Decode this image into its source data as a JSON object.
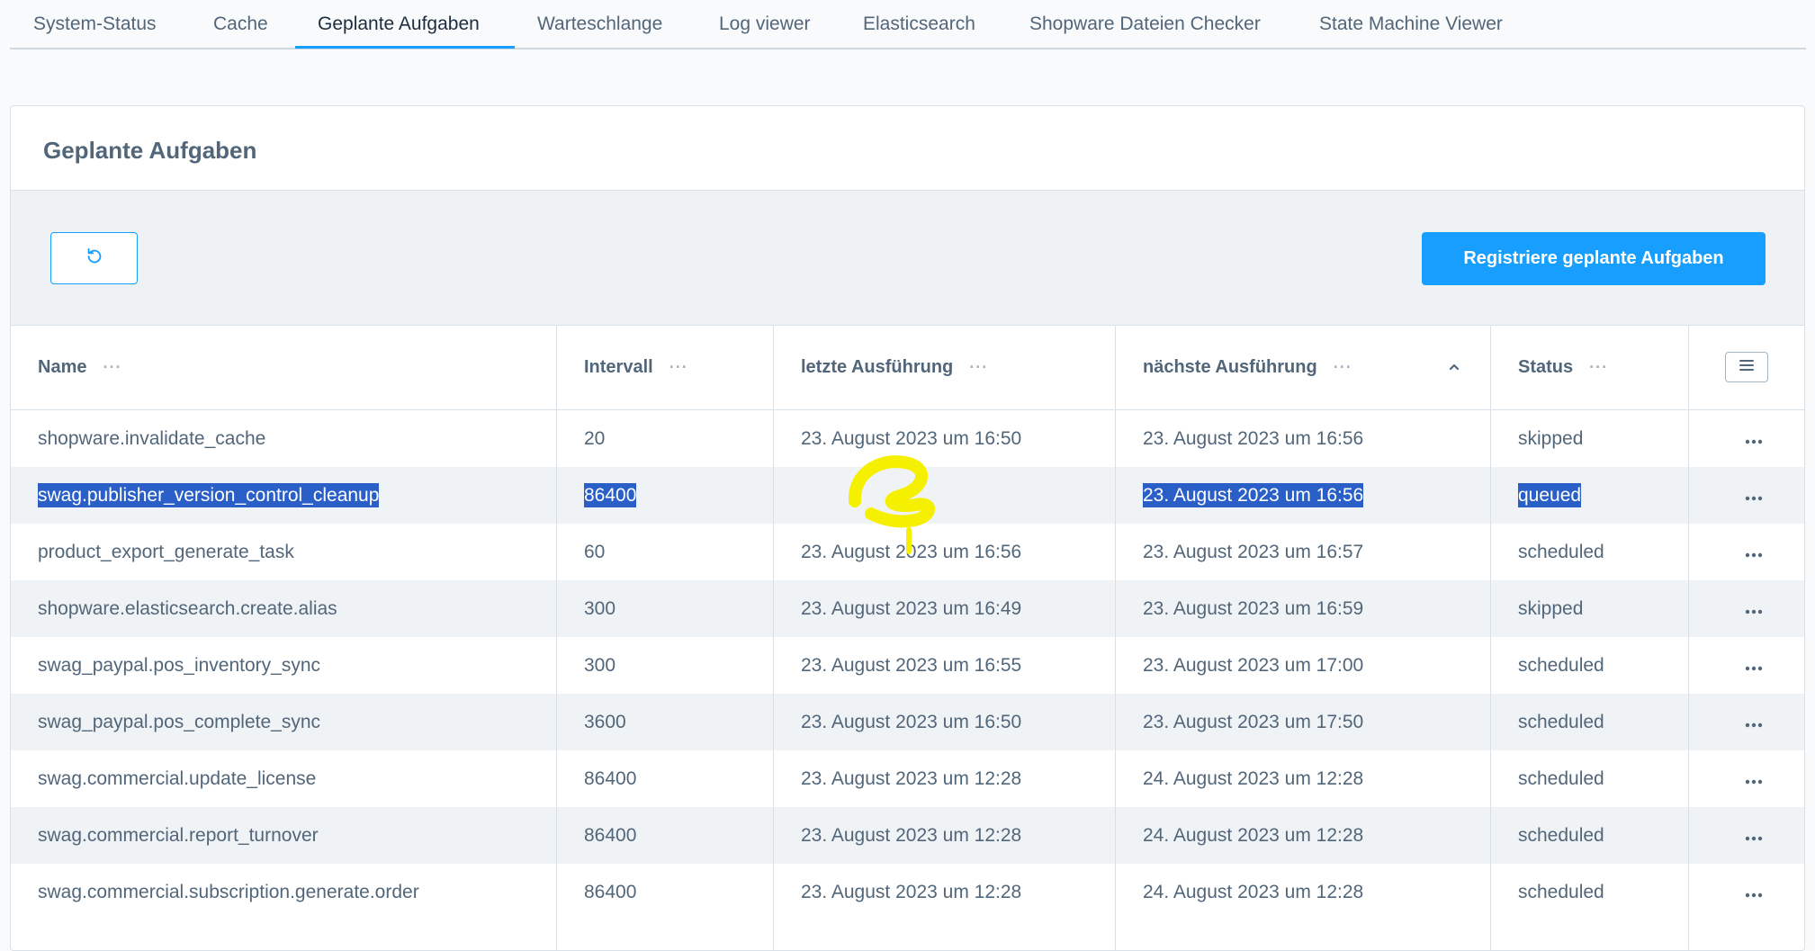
{
  "tabs": [
    {
      "label": "System-Status",
      "active": false
    },
    {
      "label": "Cache",
      "active": false
    },
    {
      "label": "Geplante Aufgaben",
      "active": true
    },
    {
      "label": "Warteschlange",
      "active": false
    },
    {
      "label": "Log viewer",
      "active": false
    },
    {
      "label": "Elasticsearch",
      "active": false
    },
    {
      "label": "Shopware Dateien Checker",
      "active": false
    },
    {
      "label": "State Machine Viewer",
      "active": false
    }
  ],
  "card": {
    "title": "Geplante Aufgaben",
    "register_label": "Registriere geplante Aufgaben",
    "refresh_icon": "refresh-icon"
  },
  "grid": {
    "columns": {
      "name": "Name",
      "interval": "Intervall",
      "last": "letzte Ausführung",
      "next": "nächste Ausführung",
      "status": "Status"
    },
    "column_menu": "···",
    "sorted_column": "next",
    "sort_direction": "ascending",
    "rows": [
      {
        "name": "shopware.invalidate_cache",
        "interval": "20",
        "last": "23. August 2023 um 16:50",
        "next": "23. August 2023 um 16:56",
        "status": "skipped",
        "selected": false
      },
      {
        "name": "swag.publisher_version_control_cleanup",
        "interval": "86400",
        "last": "",
        "next": "23. August 2023 um 16:56",
        "status": "queued",
        "selected": true
      },
      {
        "name": "product_export_generate_task",
        "interval": "60",
        "last": "23. August 2023 um 16:56",
        "next": "23. August 2023 um 16:57",
        "status": "scheduled",
        "selected": false
      },
      {
        "name": "shopware.elasticsearch.create.alias",
        "interval": "300",
        "last": "23. August 2023 um 16:49",
        "next": "23. August 2023 um 16:59",
        "status": "skipped",
        "selected": false
      },
      {
        "name": "swag_paypal.pos_inventory_sync",
        "interval": "300",
        "last": "23. August 2023 um 16:55",
        "next": "23. August 2023 um 17:00",
        "status": "scheduled",
        "selected": false
      },
      {
        "name": "swag_paypal.pos_complete_sync",
        "interval": "3600",
        "last": "23. August 2023 um 16:50",
        "next": "23. August 2023 um 17:50",
        "status": "scheduled",
        "selected": false
      },
      {
        "name": "swag.commercial.update_license",
        "interval": "86400",
        "last": "23. August 2023 um 12:28",
        "next": "24. August 2023 um 12:28",
        "status": "scheduled",
        "selected": false
      },
      {
        "name": "swag.commercial.report_turnover",
        "interval": "86400",
        "last": "23. August 2023 um 12:28",
        "next": "24. August 2023 um 12:28",
        "status": "scheduled",
        "selected": false
      },
      {
        "name": "swag.commercial.subscription.generate.order",
        "interval": "86400",
        "last": "23. August 2023 um 12:28",
        "next": "24. August 2023 um 12:28",
        "status": "scheduled",
        "selected": false
      }
    ]
  },
  "colors": {
    "accent": "#189eff",
    "selection": "#2a5fc7",
    "annotation": "#f5f000"
  }
}
